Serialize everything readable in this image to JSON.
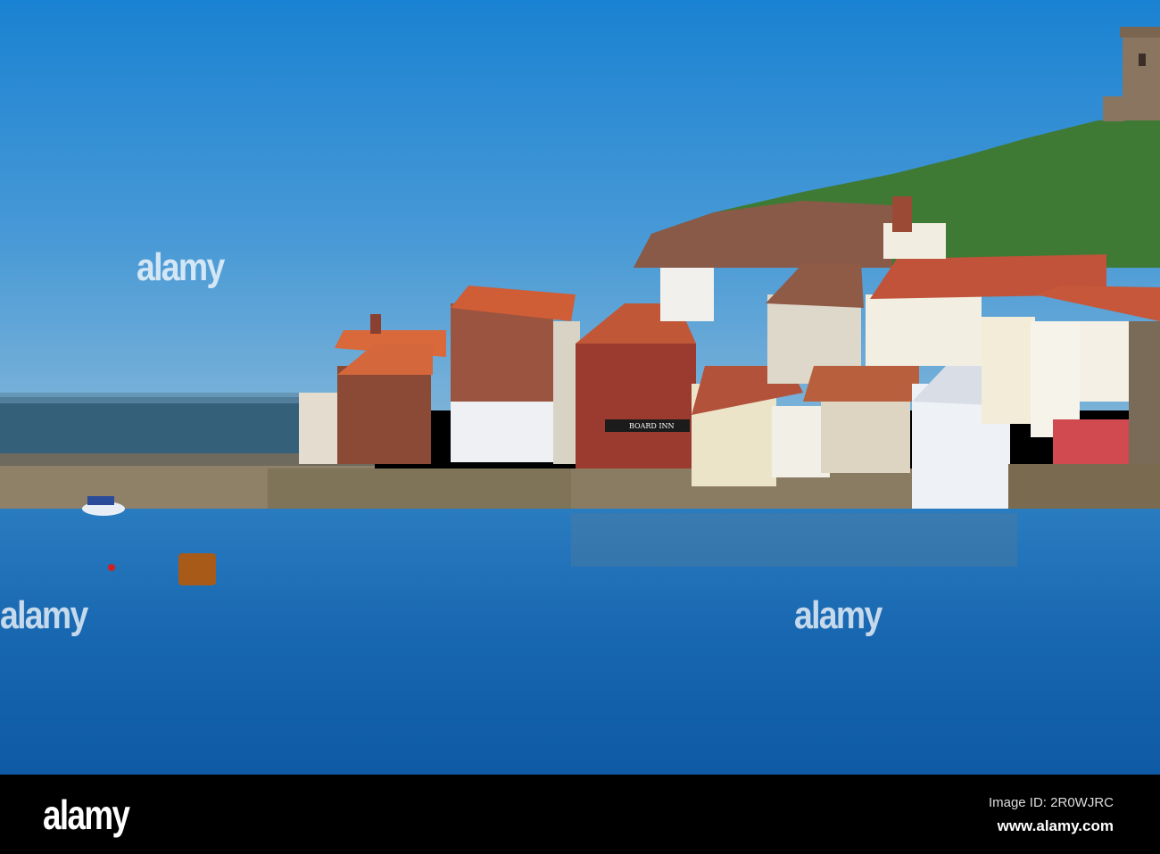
{
  "photo": {
    "sign_text": "BOARD INN",
    "watermark": "alamy"
  },
  "footer": {
    "logo": "alamy",
    "image_id": "Image ID: 2R0WJRC",
    "website": "www.alamy.com"
  },
  "colors": {
    "sky": "#1f86d4",
    "water": "#1565ad",
    "footer": "#000000"
  }
}
